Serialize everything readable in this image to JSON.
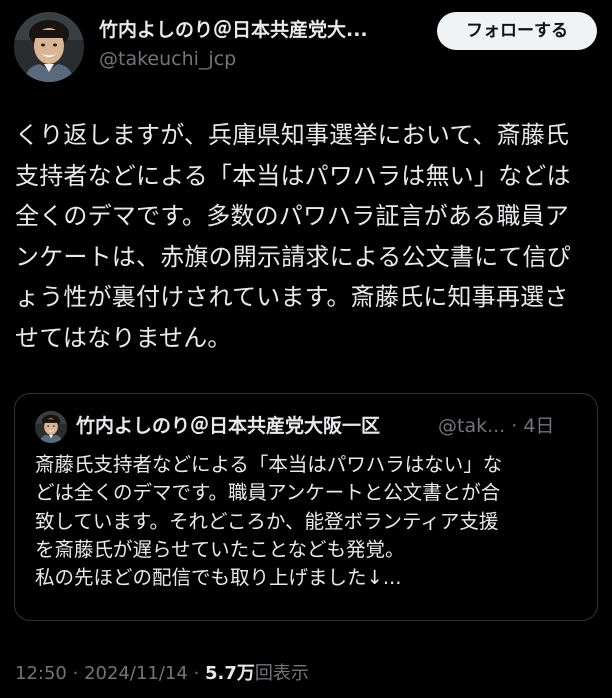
{
  "author": {
    "name": "竹内よしのり＠日本共産党大...",
    "handle": "@takeuchi_jcp"
  },
  "follow_button_label": "フォローする",
  "body_text": "くり返しますが、兵庫県知事選挙において、斎藤氏\n支持者などによる「本当はパワハラは無い」などは\n全くのデマです。多数のパワハラ証言がある職員ア\nンケートは、赤旗の開示請求による公文書にて信ぴ\nょう性が裏付けされています。斎藤氏に知事再選さ\nせてはなりません。",
  "quoted_post": {
    "author_name": "竹内よしのり＠日本共産党大阪一区",
    "handle_and_age": "@tak... · 4日",
    "text": "斎藤氏支持者などによる「本当はパワハラはない」な\nどは全くのデマです。職員アンケートと公文書とが合\n致しています。それどころか、能登ボランティア支援\nを斎藤氏が遅らせていたことなども発覚。\n私の先ほどの配信でも取り上げました↓..."
  },
  "meta": {
    "time": "12:50",
    "separator": "·",
    "date": "2024/11/14",
    "views_count": "5.7万",
    "views_label": "回表示"
  },
  "colors": {
    "background": "#000000",
    "primary_text": "#e7e9ea",
    "secondary_text": "#71767b",
    "border": "#2f3336",
    "follow_button_bg": "#eff3f4",
    "follow_button_text": "#0f1419"
  }
}
